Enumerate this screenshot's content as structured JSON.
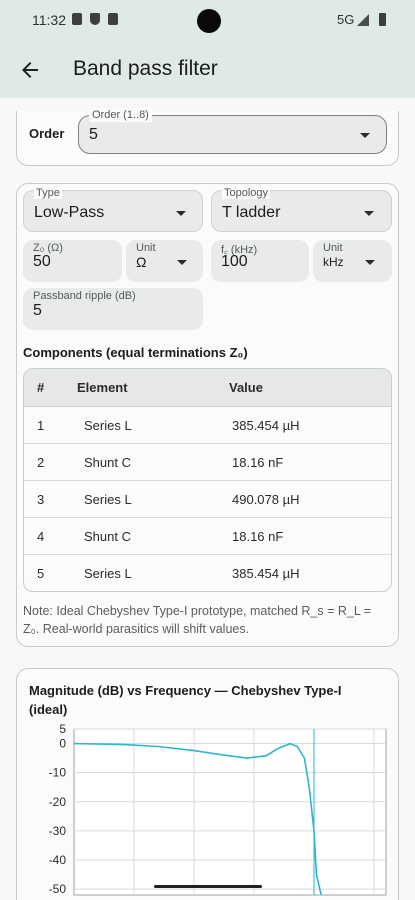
{
  "status_bar": {
    "time": "11:32",
    "network": "5G"
  },
  "app_bar": {
    "title": "Band pass filter"
  },
  "order": {
    "row_label": "Order",
    "field_label": "Order (1..8)",
    "value": "5"
  },
  "design": {
    "type": {
      "label": "Type",
      "value": "Low-Pass"
    },
    "topology": {
      "label": "Topology",
      "value": "T ladder"
    },
    "z0": {
      "label": "Z₀ (Ω)",
      "value": "50"
    },
    "z0_unit": {
      "label": "Unit",
      "value": "Ω"
    },
    "fc": {
      "label": "f꜀ (kHz)",
      "value": "100"
    },
    "fc_unit": {
      "label": "Unit",
      "value": "kHz"
    },
    "ripple": {
      "label": "Passband ripple (dB)",
      "value": "5"
    }
  },
  "components": {
    "title": "Components (equal terminations Z₀)",
    "headers": [
      "#",
      "Element",
      "Value"
    ],
    "rows": [
      [
        "1",
        "Series L",
        "385.454 µH"
      ],
      [
        "2",
        "Shunt C",
        "18.16 nF"
      ],
      [
        "3",
        "Series L",
        "490.078 µH"
      ],
      [
        "4",
        "Shunt C",
        "18.16 nF"
      ],
      [
        "5",
        "Series L",
        "385.454 µH"
      ]
    ],
    "note": "Note: Ideal Chebyshev Type-I prototype, matched R_s = R_L = Z₀. Real-world parasitics will shift values."
  },
  "chart_data": {
    "type": "line",
    "title": "Magnitude (dB) vs Frequency — Chebyshev Type-I (ideal)",
    "ylim": [
      -52,
      5
    ],
    "y_ticks": [
      5,
      0,
      -10,
      -20,
      -30,
      -40,
      -50
    ],
    "grid": true,
    "color": "#2eb5cf",
    "x": [
      0,
      0.2,
      0.35,
      0.5,
      0.62,
      0.72,
      0.8,
      0.85,
      0.9,
      0.93,
      0.96,
      0.98,
      1.0,
      1.01,
      1.03
    ],
    "values": [
      0,
      -0.3,
      -1.0,
      -2.4,
      -3.9,
      -5.0,
      -4.2,
      -1.7,
      0,
      -1.0,
      -5.0,
      -15,
      -30,
      -45,
      -52
    ],
    "marker_x": 1.0
  },
  "colors": {
    "header_bg": "#dfe9e6",
    "accent": "#2eb5cf"
  }
}
